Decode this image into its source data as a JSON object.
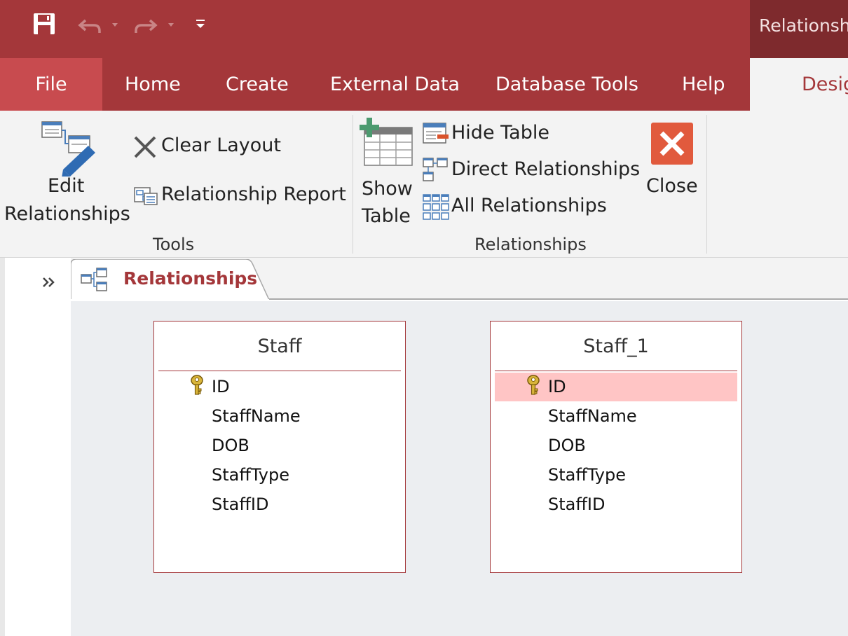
{
  "window": {
    "title": "Relationshi"
  },
  "qat": {
    "save_icon": "save-icon",
    "undo_icon": "undo-icon",
    "redo_icon": "redo-icon",
    "customize_icon": "customize-qat-icon"
  },
  "tabs": [
    {
      "label": "File"
    },
    {
      "label": "Home"
    },
    {
      "label": "Create"
    },
    {
      "label": "External Data"
    },
    {
      "label": "Database Tools"
    },
    {
      "label": "Help"
    },
    {
      "label": "Desig"
    }
  ],
  "ribbon": {
    "tools": {
      "edit_line1": "Edit",
      "edit_line2": "Relationships",
      "clear_layout": "Clear Layout",
      "relationship_report": "Relationship Report",
      "group_label": "Tools"
    },
    "relationships": {
      "show_line1": "Show",
      "show_line2": "Table",
      "hide_table": "Hide Table",
      "direct_relationships": "Direct Relationships",
      "all_relationships": "All Relationships",
      "close": "Close",
      "group_label": "Relationships"
    }
  },
  "document_tab": {
    "label": "Relationships"
  },
  "tables": [
    {
      "title": "Staff",
      "fields": [
        "ID",
        "StaffName",
        "DOB",
        "StaffType",
        "StaffID"
      ],
      "selected_field": -1
    },
    {
      "title": "Staff_1",
      "fields": [
        "ID",
        "StaffName",
        "DOB",
        "StaffType",
        "StaffID"
      ],
      "selected_field": 0
    }
  ],
  "colors": {
    "accent": "#a4373a",
    "tab_file": "#c84b4f",
    "selection": "#ffc5c5",
    "close_button": "#e15a3d"
  }
}
